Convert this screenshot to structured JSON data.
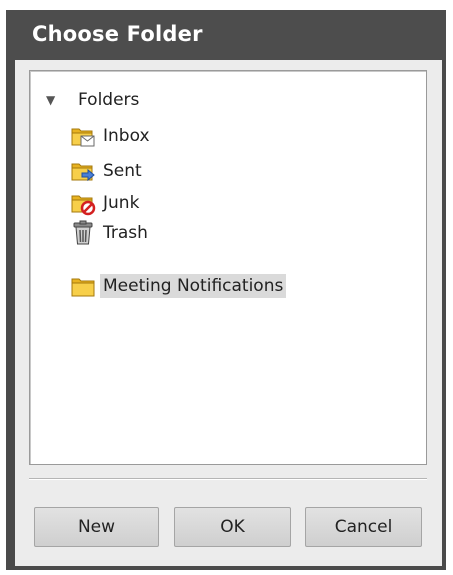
{
  "dialog": {
    "title": "Choose Folder"
  },
  "tree": {
    "root": {
      "label": "Folders",
      "expanded": true,
      "icon": "triangle-down-icon"
    },
    "items": [
      {
        "label": "Inbox",
        "icon": "inbox-folder-icon",
        "selected": false
      },
      {
        "label": "Sent",
        "icon": "sent-folder-icon",
        "selected": false
      },
      {
        "label": "Junk",
        "icon": "junk-folder-icon",
        "selected": false
      },
      {
        "label": "Trash",
        "icon": "trash-can-icon",
        "selected": false
      },
      {
        "label": "Meeting Notifications",
        "icon": "folder-icon",
        "selected": true
      }
    ]
  },
  "buttons": {
    "new_label": "New",
    "ok_label": "OK",
    "cancel_label": "Cancel"
  },
  "colors": {
    "titlebar": "#4d4d4d",
    "folder_yellow": "#f2c12e",
    "selection": "#dadada"
  }
}
